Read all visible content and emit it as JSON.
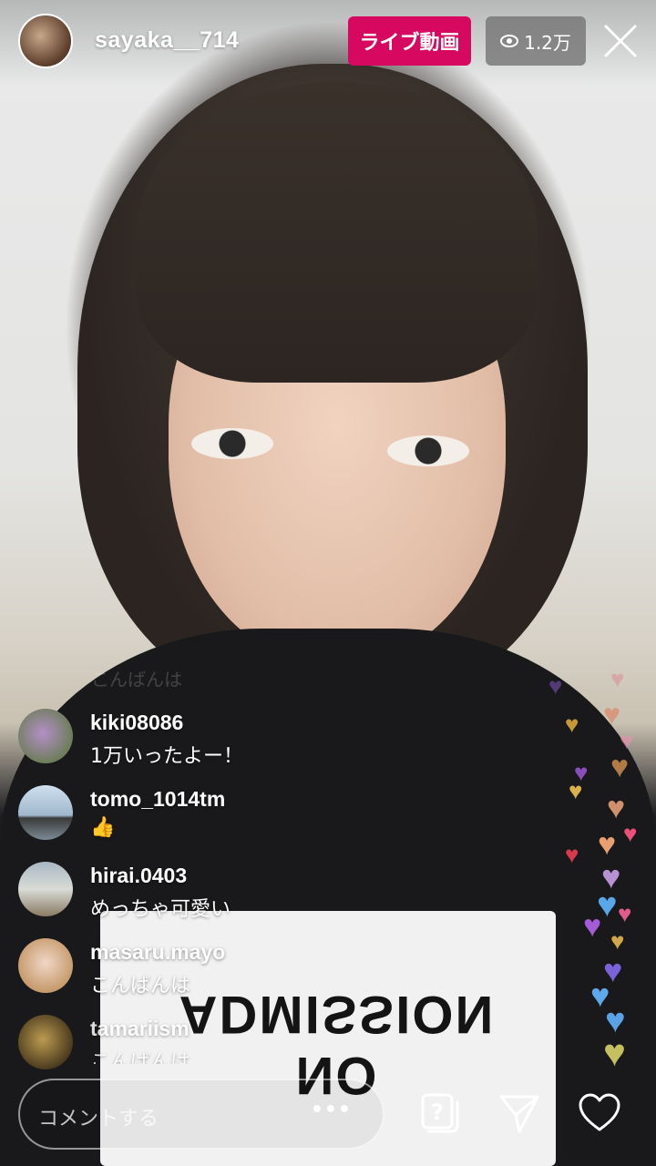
{
  "host": {
    "username": "sayaka__714",
    "avatar_icon": "host-avatar"
  },
  "live_badge": "ライブ動画",
  "viewers": {
    "icon": "eye-icon",
    "count": "1.2万"
  },
  "faded_previous_comment": "こんばんは",
  "comments": [
    {
      "user": "kiki08086",
      "text": "1万いったよー！",
      "avatar_color": "#8a7aa0"
    },
    {
      "user": "tomo_1014tm",
      "text": "👍",
      "avatar_color": "#7a9ab8"
    },
    {
      "user": "hirai.0403",
      "text": "めっちゃ可愛い",
      "avatar_color": "#7e8a80"
    },
    {
      "user": "masaru.mayo",
      "text": "こんばんは",
      "avatar_color": "#c9a48a"
    },
    {
      "user": "tamariism",
      "text": "こんばんは",
      "avatar_color": "#8c7a44"
    }
  ],
  "bottom_bar": {
    "comment_placeholder": "コメントする",
    "more_label": "•••"
  },
  "shirt_print": "NO ADMISSION",
  "colors": {
    "live_badge": "#d6085f",
    "viewer_badge": "#6e6e6e"
  }
}
